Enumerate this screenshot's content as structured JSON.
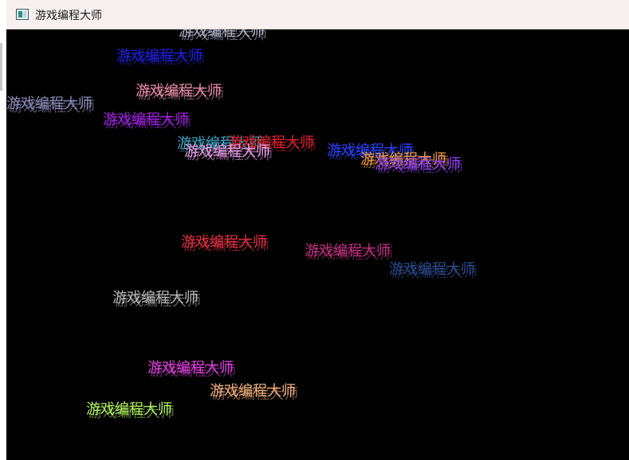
{
  "window": {
    "title": "游戏编程大师"
  },
  "canvas_text": "游戏编程大师",
  "labels": [
    {
      "color": "#b0b0c0",
      "ghost": "#6a6a80"
    },
    {
      "color": "#1e1ee0",
      "ghost": "#12127a"
    },
    {
      "color": "#e88aa8",
      "ghost": "#7a4a58"
    },
    {
      "color": "#8a8ab8",
      "ghost": "#555570"
    },
    {
      "color": "#a020e0",
      "ghost": "#5a1280"
    },
    {
      "color": "#3aa0c0",
      "ghost": "#1f5060"
    },
    {
      "color": "#e02030",
      "ghost": "#701018"
    },
    {
      "color": "#e8a0e8",
      "ghost": "#805080"
    },
    {
      "color": "#2a40ff",
      "ghost": "#14207a"
    },
    {
      "color": "#f0a040",
      "ghost": "#805020"
    },
    {
      "color": "#9040f0",
      "ghost": "#4a2080"
    },
    {
      "color": "#e03040",
      "ghost": "#801828"
    },
    {
      "color": "#c03080",
      "ghost": "#601840"
    },
    {
      "color": "#2a4a8a",
      "ghost": "#182a50"
    },
    {
      "color": "#b8b8b8",
      "ghost": "#606060"
    },
    {
      "color": "#e040e0",
      "ghost": "#702070"
    },
    {
      "color": "#f0b080",
      "ghost": "#805840"
    },
    {
      "color": "#b0f060",
      "ghost": "#587830"
    }
  ]
}
